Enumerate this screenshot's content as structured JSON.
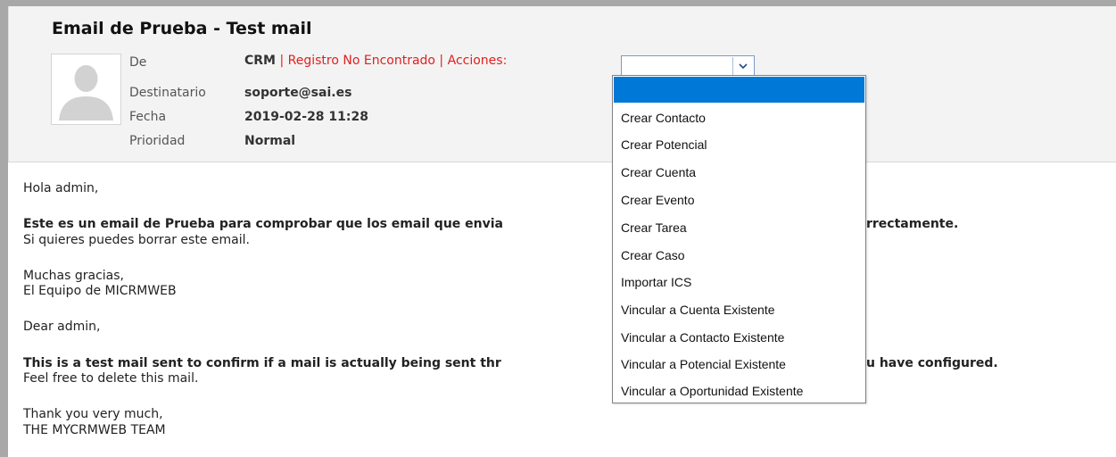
{
  "email": {
    "subject": "Email de Prueba - Test mail",
    "labels": {
      "from": "De",
      "to": "Destinatario",
      "date": "Fecha",
      "priority": "Prioridad"
    },
    "from": {
      "name": "CRM",
      "separator1": " | ",
      "not_found": "Registro No Encontrado",
      "separator2": " | ",
      "actions": "Acciones:"
    },
    "to": "soporte@sai.es",
    "date": "2019-02-28 11:28",
    "priority": "Normal",
    "avatar_icon": "user-silhouette-icon"
  },
  "actions_select": {
    "selected": "",
    "options": [
      "",
      "Crear Contacto",
      "Crear Potencial",
      "Crear Cuenta",
      "Crear Evento",
      "Crear Tarea",
      "Crear Caso",
      "Importar ICS",
      "Vincular a Cuenta Existente",
      "Vincular a Contacto Existente",
      "Vincular a Potencial Existente",
      "Vincular a Oportunidad Existente"
    ],
    "highlight_color": "#0078d7"
  },
  "body": {
    "greeting_es": "Hola admin,",
    "main_es_part1": "Este es un email de Prueba para comprobar que los email que envia",
    "main_es_part2": "rrectamente.",
    "delete_es": "Si quieres puedes borrar este email.",
    "thanks_es": "Muchas gracias,",
    "team_es": "El Equipo de MICRMWEB",
    "greeting_en": "Dear admin,",
    "main_en_part1": "This is a test mail sent to confirm if a mail is actually being sent thr",
    "main_en_part2": "u have configured.",
    "delete_en": "Feel free to delete this mail.",
    "thanks_en": "Thank you very much,",
    "team_en": "THE MYCRMWEB TEAM"
  },
  "colors": {
    "header_bg": "#f3f3f3",
    "alert_red": "#e02020",
    "frame_gray": "#a8a8a8"
  }
}
